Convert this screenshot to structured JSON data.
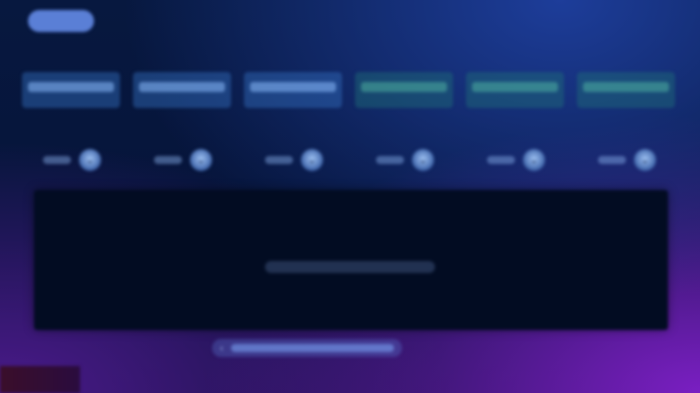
{
  "header": {
    "pill_label": ""
  },
  "section": {
    "label": ""
  },
  "tabs": [
    {
      "label": "",
      "accent": "#6fa8ff"
    },
    {
      "label": "",
      "accent": "#6fa8ff"
    },
    {
      "label": "",
      "accent": "#6fa8ff"
    },
    {
      "label": "",
      "accent": "#5ac8aa"
    },
    {
      "label": "",
      "accent": "#5ac8aa"
    },
    {
      "label": "",
      "accent": "#5ac8aa"
    }
  ],
  "steppers": [
    {
      "value": "",
      "icon": "chevron-icon"
    },
    {
      "value": "",
      "icon": "chevron-icon"
    },
    {
      "value": "",
      "icon": "chevron-icon"
    },
    {
      "value": "",
      "icon": "chevron-icon"
    },
    {
      "value": "",
      "icon": "chevron-icon"
    },
    {
      "value": "",
      "icon": "chevron-icon"
    }
  ],
  "panel": {
    "message": ""
  },
  "bottom_bar": {
    "label": "",
    "icon": "arrow-left-icon"
  },
  "colors": {
    "background": "#06143a",
    "panel": "#020c22",
    "accent_blue": "#6fa8ff",
    "accent_teal": "#5ac8aa"
  }
}
